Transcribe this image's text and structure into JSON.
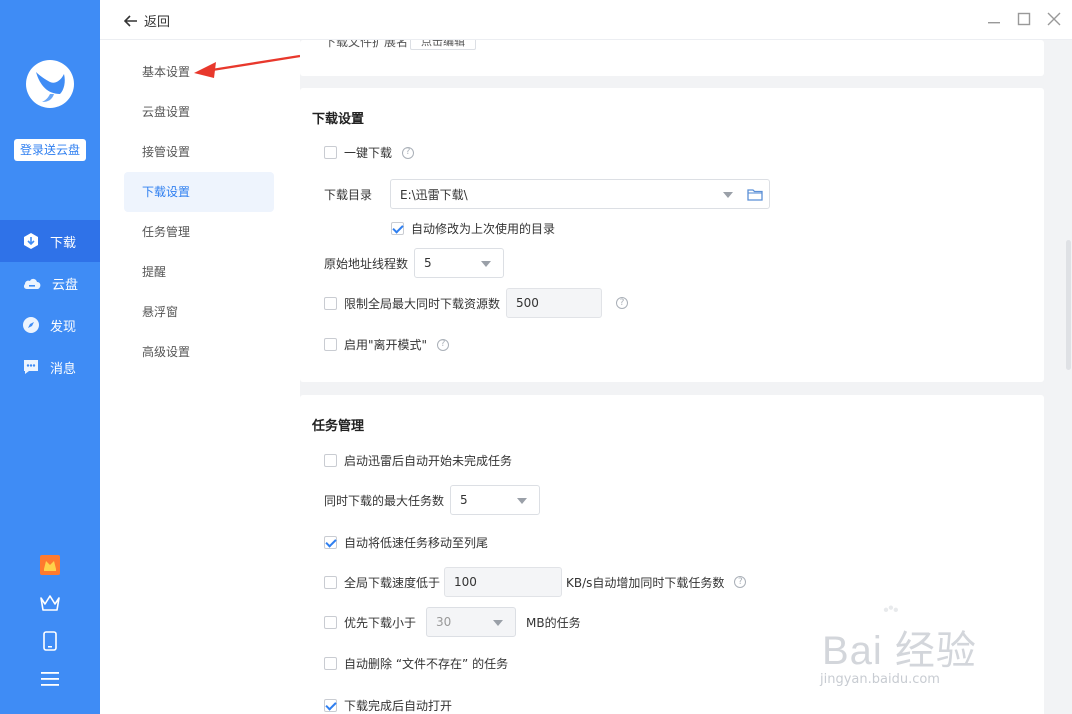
{
  "sidebar": {
    "login_label": "登录送云盘",
    "nav": [
      {
        "label": "下载",
        "icon": "download-icon",
        "active": true
      },
      {
        "label": "云盘",
        "icon": "cloud-icon",
        "active": false
      },
      {
        "label": "发现",
        "icon": "compass-icon",
        "active": false
      },
      {
        "label": "消息",
        "icon": "message-icon",
        "active": false
      }
    ],
    "bottom_icons": [
      "gift-icon",
      "crown-icon",
      "phone-icon",
      "menu-icon"
    ]
  },
  "topbar": {
    "back_label": "返回"
  },
  "settings_nav": {
    "items": [
      {
        "label": "基本设置",
        "active": false
      },
      {
        "label": "云盘设置",
        "active": false
      },
      {
        "label": "接管设置",
        "active": false
      },
      {
        "label": "下载设置",
        "active": true
      },
      {
        "label": "任务管理",
        "active": false
      },
      {
        "label": "提醒",
        "active": false
      },
      {
        "label": "悬浮窗",
        "active": false
      },
      {
        "label": "高级设置",
        "active": false
      }
    ]
  },
  "top_partial": {
    "label": "下载文件扩展名",
    "button": "点击编辑"
  },
  "download_settings": {
    "title": "下载设置",
    "one_click": {
      "label": "一键下载",
      "checked": false
    },
    "dir_label": "下载目录",
    "dir_value": "E:\\迅雷下载\\",
    "auto_dir": {
      "label": "自动修改为上次使用的目录",
      "checked": true
    },
    "threads_label": "原始地址线程数",
    "threads_value": "5",
    "limit_sources": {
      "label": "限制全局最大同时下载资源数",
      "checked": false,
      "value": "500"
    },
    "leave_mode": {
      "label": "启用\"离开模式\"",
      "checked": false
    }
  },
  "task_management": {
    "title": "任务管理",
    "auto_start": {
      "label": "启动迅雷后自动开始未完成任务",
      "checked": false
    },
    "max_tasks_label": "同时下载的最大任务数",
    "max_tasks_value": "5",
    "move_slow": {
      "label": "自动将低速任务移动至列尾",
      "checked": true
    },
    "speed_low": {
      "label": "全局下载速度低于",
      "value": "100",
      "suffix": "KB/s自动增加同时下载任务数",
      "checked": false
    },
    "prefer_small": {
      "label": "优先下载小于",
      "value": "30",
      "suffix": "MB的任务",
      "checked": false
    },
    "auto_delete": {
      "label": "自动删除 “文件不存在” 的任务",
      "checked": false
    },
    "open_after": {
      "label": "下载完成后自动打开",
      "checked": true
    }
  },
  "watermark": {
    "brand": "Bai 经验",
    "url": "jingyan.baidu.com"
  },
  "colors": {
    "accent": "#3f8cf5",
    "active_text": "#2f7ff0",
    "annotation": "#e8382c"
  }
}
